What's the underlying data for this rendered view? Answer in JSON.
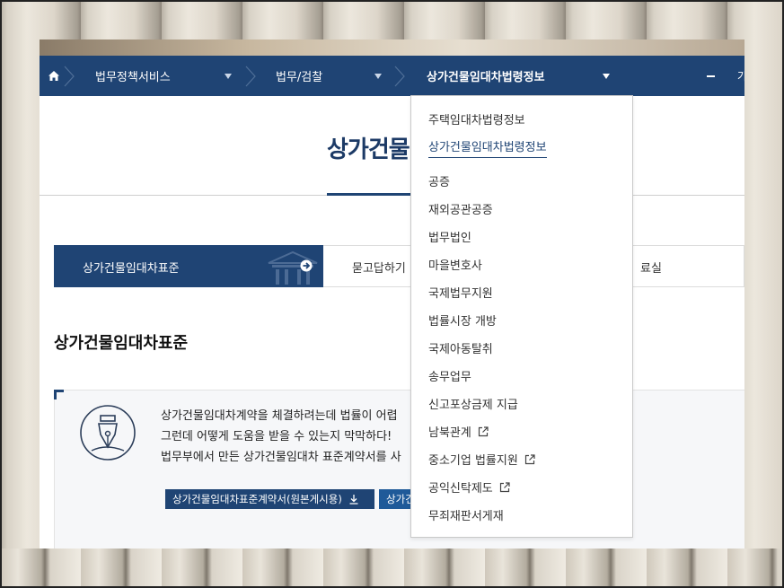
{
  "nav": {
    "items": [
      {
        "label": "법무정책서비스"
      },
      {
        "label": "법무/검찰"
      },
      {
        "label": "상가건물임대차법령정보"
      }
    ],
    "edge_text": "가"
  },
  "page": {
    "title": "상가건물임대차법령정보"
  },
  "tabs": [
    {
      "label": "상가건물임대차표준",
      "active": true
    },
    {
      "label": "묻고답하기"
    },
    {
      "label": "료실"
    }
  ],
  "section": {
    "title": "상가건물임대차표준"
  },
  "info": {
    "lines": [
      "상가건물임대차계약을 체결하려는데 법률이 어렵",
      "그런데 어떻게 도움을 받을 수 있는지 막막하다!",
      "법무부에서 만든 상가건물임대차 표준계약서를 사"
    ],
    "buttons": [
      {
        "label": "상가건물임대차표준계약서(원본게시용)"
      },
      {
        "label": "상가건"
      }
    ]
  },
  "dropdown": {
    "items": [
      {
        "label": "주택임대차법령정보",
        "external": false
      },
      {
        "label": "상가건물임대차법령정보",
        "external": false,
        "active": true
      },
      {
        "label": "공증",
        "external": false
      },
      {
        "label": "재외공관공증",
        "external": false
      },
      {
        "label": "법무법인",
        "external": false
      },
      {
        "label": "마을변호사",
        "external": false
      },
      {
        "label": "국제법무지원",
        "external": false
      },
      {
        "label": "법률시장 개방",
        "external": false
      },
      {
        "label": "국제아동탈취",
        "external": false
      },
      {
        "label": "송무업무",
        "external": false
      },
      {
        "label": "신고포상금제 지급",
        "external": false
      },
      {
        "label": "남북관계",
        "external": true
      },
      {
        "label": "중소기업 법률지원",
        "external": true
      },
      {
        "label": "공익신탁제도",
        "external": true
      },
      {
        "label": "무죄재판서게재",
        "external": false
      }
    ]
  },
  "colors": {
    "primary": "#1f4474",
    "tab_active": "#1f4474",
    "dropdown_active": "#1f4474"
  },
  "icons": {
    "home": "home-icon",
    "caret": "caret-down-icon",
    "external": "external-link-icon",
    "download": "download-icon",
    "pen": "fountain-pen-icon",
    "arrow": "arrow-right-circle-icon"
  }
}
